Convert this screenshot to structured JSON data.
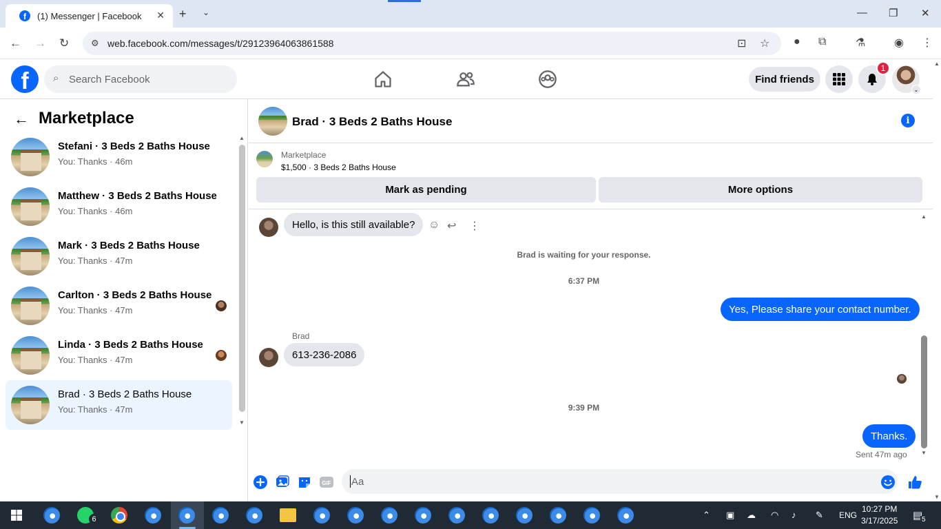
{
  "browser": {
    "tab_title": "(1) Messenger | Facebook",
    "url": "web.facebook.com/messages/t/29123964063861588"
  },
  "header": {
    "search_placeholder": "Search Facebook",
    "find_friends": "Find friends",
    "notification_count": "1"
  },
  "sidebar": {
    "title": "Marketplace",
    "conversations": [
      {
        "name": "Stefani · 3 Beds 2 Baths House",
        "preview": "You: Thanks · 46m"
      },
      {
        "name": "Matthew · 3 Beds 2 Baths House",
        "preview": "You: Thanks · 46m"
      },
      {
        "name": "Mark · 3 Beds 2 Baths House",
        "preview": "You: Thanks · 47m"
      },
      {
        "name": "Carlton · 3 Beds 2 Baths House",
        "preview": "You: Thanks · 47m"
      },
      {
        "name": "Linda · 3 Beds 2 Baths House",
        "preview": "You: Thanks · 47m"
      },
      {
        "name": "Brad · 3 Beds 2 Baths House",
        "preview": "You: Thanks · 47m"
      }
    ]
  },
  "chat": {
    "title": "Brad · 3 Beds 2 Baths House",
    "listing_category": "Marketplace",
    "listing_desc": "$1,500 · 3 Beds 2 Baths House",
    "mark_pending": "Mark as pending",
    "more_options": "More options",
    "msg1": "Hello, is this still available?",
    "waiting": "Brad is waiting for your response.",
    "time1": "6:37 PM",
    "msg2": "Yes, Please share your contact number.",
    "sender": "Brad",
    "msg3": "613-236-2086",
    "time2": "9:39 PM",
    "msg4": "Thanks.",
    "sent_status": "Sent 47m ago",
    "composer_placeholder": "Aa"
  },
  "taskbar": {
    "whatsapp_badge": "6",
    "lang": "ENG",
    "time": "10:27 PM",
    "date": "3/17/2025",
    "notif_count": "5"
  },
  "colors": {
    "fb_blue": "#0866ff",
    "bubble_in": "#e4e6eb",
    "active_row": "#ebf5ff",
    "taskbar": "#202a35"
  }
}
